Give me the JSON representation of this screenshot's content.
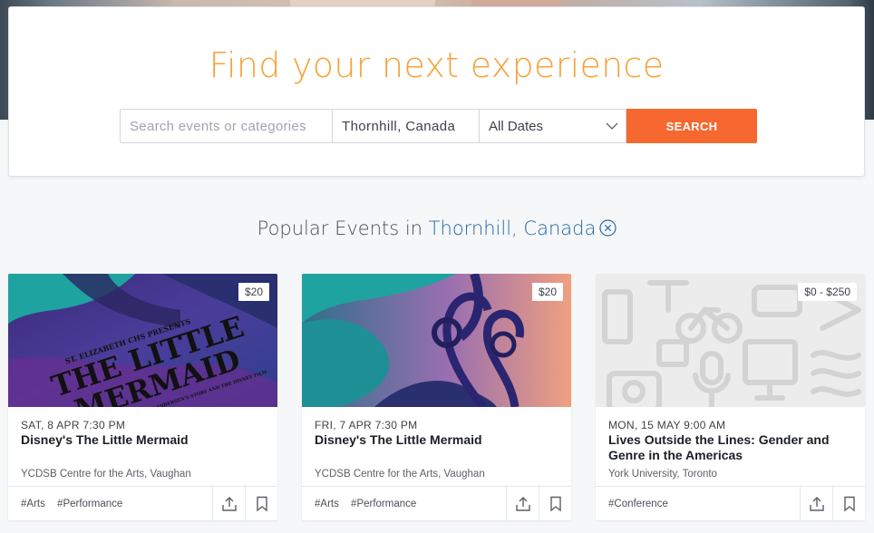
{
  "hero": {
    "title": "Find your next experience"
  },
  "search": {
    "keyword_placeholder": "Search events or categories",
    "location": "Thornhill, Canada",
    "dates": "All Dates",
    "button": "SEARCH"
  },
  "popular": {
    "prefix": "Popular Events in",
    "city": "Thornhill, Canada"
  },
  "events": [
    {
      "price": "$20",
      "date": "SAT, 8 APR 7:30 PM",
      "title": "Disney's The Little Mermaid",
      "venue": "YCDSB Centre for the Arts, Vaughan",
      "tags": [
        "#Arts",
        "#Performance"
      ],
      "poster": {
        "line1": "ST. ELIZABETH CHS PRESENTS",
        "line2": "THE LITTLE",
        "line3": "MERMAID",
        "line4": "BASED ON HANS CHRISTIAN ANDERSEN'S STORY AND THE DISNEY FILM"
      }
    },
    {
      "price": "$20",
      "date": "FRI, 7 APR 7:30 PM",
      "title": "Disney's The Little Mermaid",
      "venue": "YCDSB Centre for the Arts, Vaughan",
      "tags": [
        "#Arts",
        "#Performance"
      ]
    },
    {
      "price": "$0 - $250",
      "date": "MON, 15 MAY 9:00 AM",
      "title": "Lives Outside the Lines: Gender and Genre in the Americas",
      "venue": "York University, Toronto",
      "tags": [
        "#Conference"
      ]
    }
  ],
  "colors": {
    "accent_orange": "#f6682f",
    "title_orange": "#f6a23a",
    "link_blue": "#1f6aa5"
  },
  "icons": [
    "chevron-down-icon",
    "clear-circle-icon",
    "share-icon",
    "bookmark-icon"
  ]
}
